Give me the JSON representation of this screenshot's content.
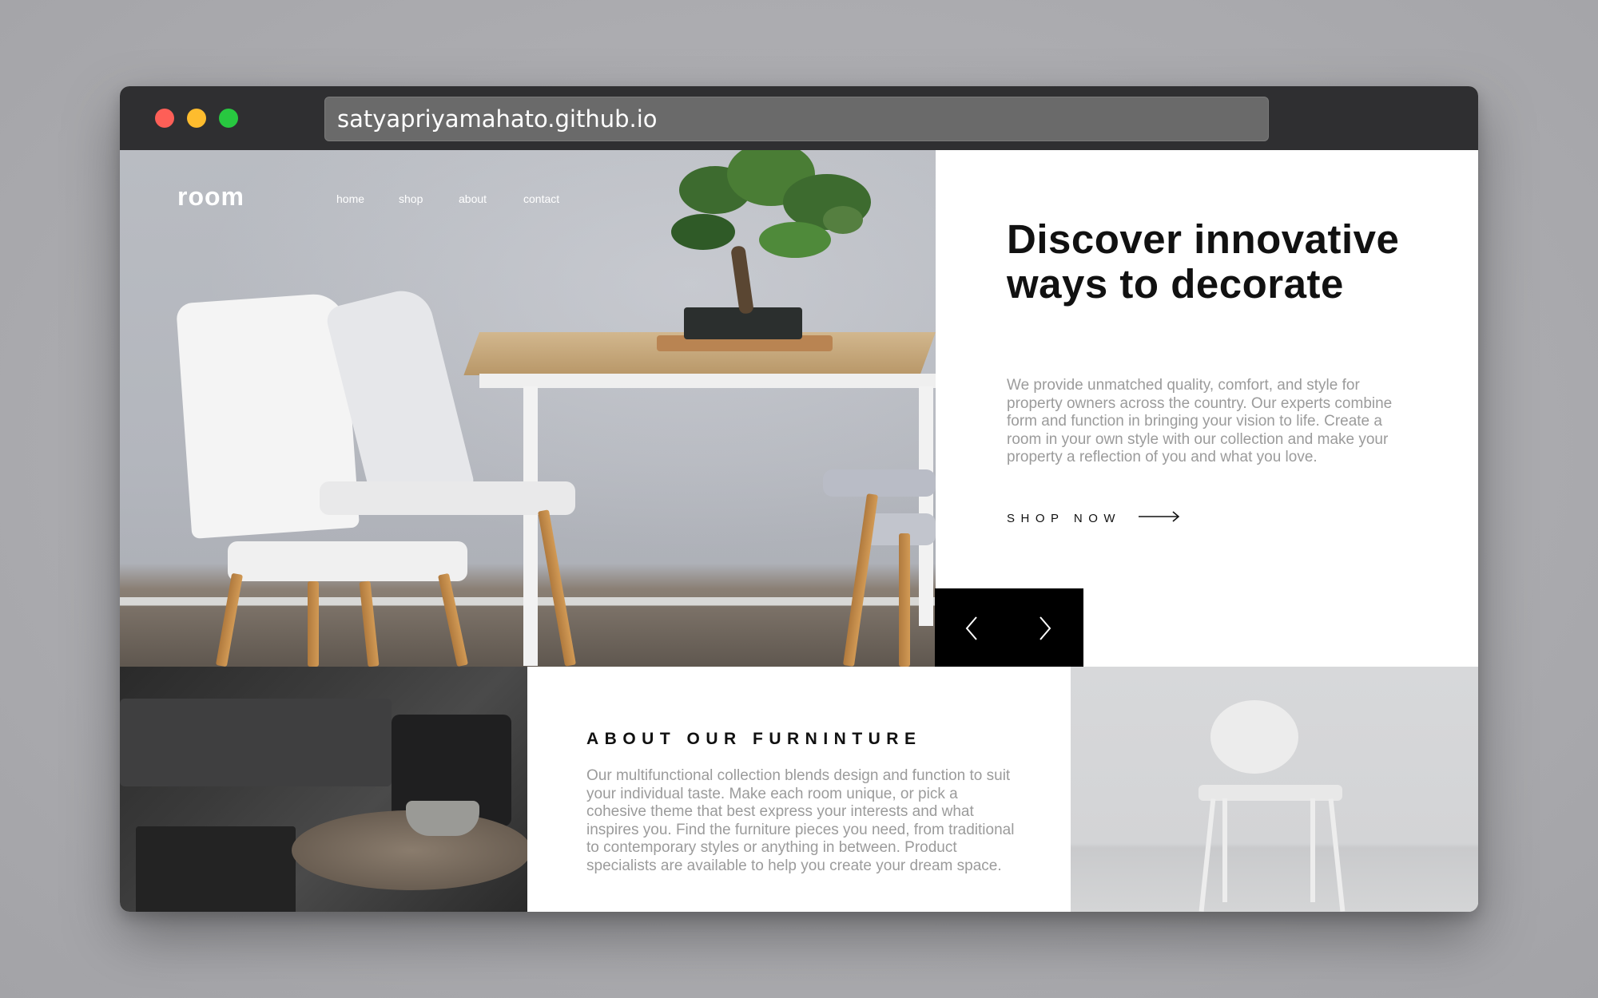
{
  "browser": {
    "url": "satyapriyamahato.github.io"
  },
  "header": {
    "logo": "room",
    "nav": [
      {
        "label": "home"
      },
      {
        "label": "shop"
      },
      {
        "label": "about"
      },
      {
        "label": "contact"
      }
    ]
  },
  "hero": {
    "title": "Discover innovative ways to decorate",
    "description": "We provide unmatched quality, comfort, and style for property owners across the country. Our experts combine form and function in bringing your vision to life. Create a room in your own style with our collection and make your property a reflection of you and what you love.",
    "cta_label": "SHOP NOW"
  },
  "about": {
    "title": "ABOUT OUR FURNINTURE",
    "description": "Our multifunctional collection blends design and function to suit your individual taste. Make each room unique, or pick a cohesive theme that best express your interests and what inspires you. Find the furniture pieces you need, from traditional to contemporary styles or anything in between. Product specialists are available to help you create your dream space."
  }
}
